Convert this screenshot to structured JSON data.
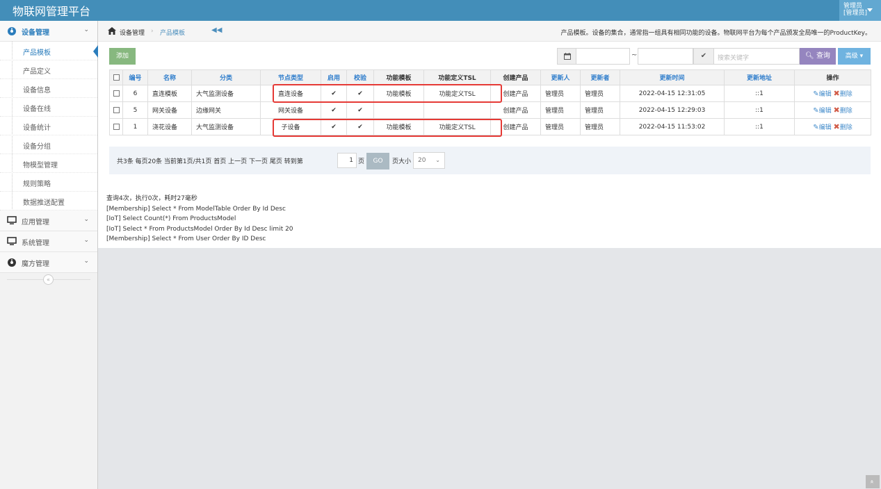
{
  "app": {
    "title": "物联网管理平台",
    "user_line1": "管理员",
    "user_line2": "[管理员]"
  },
  "sidebar": {
    "device_mgmt": "设备管理",
    "sub": [
      "产品模板",
      "产品定义",
      "设备信息",
      "设备在线",
      "设备统计",
      "设备分组",
      "物模型管理",
      "规则策略",
      "数据推送配置"
    ],
    "app_mgmt": "应用管理",
    "sys_mgmt": "系统管理",
    "cube_mgmt": "魔方管理",
    "collapse": "«"
  },
  "breadcrumb": {
    "level1": "设备管理",
    "sep": "›",
    "level2": "产品模板",
    "back": "◀◀",
    "description": "产品模板。设备的集合，通常指一组具有相同功能的设备。物联网平台为每个产品颁发全局唯一的ProductKey。"
  },
  "toolbar": {
    "add": "添加",
    "tilde": "~",
    "search_placeholder": "搜索关键字",
    "query": "查询",
    "advanced": "高级"
  },
  "table": {
    "headers": [
      "编号",
      "名称",
      "分类",
      "节点类型",
      "启用",
      "校验",
      "功能模板",
      "功能定义TSL",
      "创建产品",
      "更新人",
      "更新者",
      "更新时间",
      "更新地址",
      "操作"
    ],
    "rows": [
      {
        "id": "6",
        "name": "直连模板",
        "category": "大气监测设备",
        "node": "直连设备",
        "enabled": "✔",
        "verified": "✔",
        "tpl": "功能模板",
        "tsl": "功能定义TSL",
        "create": "创建产品",
        "updater": "管理员",
        "updater2": "管理员",
        "time": "2022-04-15 12:31:05",
        "addr": "::1",
        "edit": "编辑",
        "del": "删除"
      },
      {
        "id": "5",
        "name": "网关设备",
        "category": "边缘网关",
        "node": "网关设备",
        "enabled": "✔",
        "verified": "✔",
        "tpl": "",
        "tsl": "",
        "create": "创建产品",
        "updater": "管理员",
        "updater2": "管理员",
        "time": "2022-04-15 12:29:03",
        "addr": "::1",
        "edit": "编辑",
        "del": "删除"
      },
      {
        "id": "1",
        "name": "浇花设备",
        "category": "大气监测设备",
        "node": "子设备",
        "enabled": "✔",
        "verified": "✔",
        "tpl": "功能模板",
        "tsl": "功能定义TSL",
        "create": "创建产品",
        "updater": "管理员",
        "updater2": "管理员",
        "time": "2022-04-15 11:53:02",
        "addr": "::1",
        "edit": "编辑",
        "del": "删除"
      }
    ]
  },
  "pager": {
    "summary": "共3条  每页20条  当前第1页/共1页  首页  上一页  下一页  尾页  转到第",
    "page_value": "1",
    "page_unit": "页",
    "go": "GO",
    "size_label": "页大小",
    "size_value": "20"
  },
  "log": {
    "lines": [
      "查询4次，执行0次，耗时27毫秒",
      "[Membership] Select * From ModelTable Order By Id Desc",
      "[IoT] Select Count(*) From ProductsModel",
      "[IoT] Select * From ProductsModel Order By Id Desc limit 20",
      "[Membership] Select * From User Order By ID Desc"
    ]
  },
  "scroll_top": "»"
}
